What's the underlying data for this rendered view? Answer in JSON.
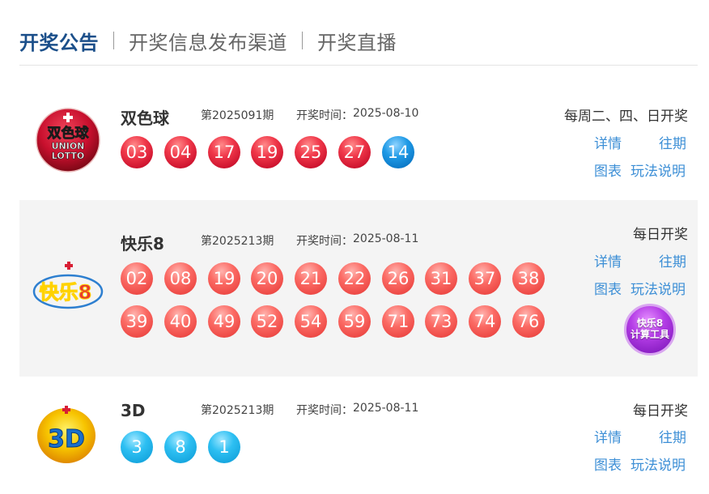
{
  "tabs": [
    {
      "label": "开奖公告",
      "active": true
    },
    {
      "label": "开奖信息发布渠道",
      "active": false
    },
    {
      "label": "开奖直播",
      "active": false
    }
  ],
  "ssq": {
    "name": "双色球",
    "issue": "第2025091期",
    "draw_time_label": "开奖时间：",
    "draw_date": "2025-08-10",
    "schedule": "每周二、四、日开奖",
    "logo_text_cn": "双色球",
    "logo_text_en1": "UNION",
    "logo_text_en2": "LOTTO",
    "red_balls": [
      "03",
      "04",
      "17",
      "19",
      "25",
      "27"
    ],
    "blue_balls": [
      "14"
    ],
    "links": {
      "detail": "详情",
      "history": "往期",
      "chart": "图表",
      "rules": "玩法说明"
    }
  },
  "kl8": {
    "name": "快乐8",
    "issue": "第2025213期",
    "draw_time_label": "开奖时间：",
    "draw_date": "2025-08-11",
    "schedule": "每日开奖",
    "logo_text": "快乐8",
    "balls": [
      "02",
      "08",
      "19",
      "20",
      "21",
      "22",
      "26",
      "31",
      "37",
      "38",
      "39",
      "40",
      "49",
      "52",
      "54",
      "59",
      "71",
      "73",
      "74",
      "76"
    ],
    "calc_line1": "快乐8",
    "calc_line2": "计算工具",
    "links": {
      "detail": "详情",
      "history": "往期",
      "chart": "图表",
      "rules": "玩法说明"
    }
  },
  "fc3d": {
    "name": "3D",
    "issue": "第2025213期",
    "draw_time_label": "开奖时间：",
    "draw_date": "2025-08-11",
    "schedule": "每日开奖",
    "logo_text": "3D",
    "balls": [
      "3",
      "8",
      "1"
    ],
    "links": {
      "detail": "详情",
      "history": "往期",
      "chart": "图表",
      "rules": "玩法说明"
    }
  },
  "colors": {
    "tab_active": "#1b4f8a",
    "link": "#3d8fd6",
    "red_ball": "#d81e34",
    "blue_ball": "#0a80d0",
    "pink_ball": "#f25650",
    "cyan_ball": "#1cb1e8",
    "calc_button": "#9b2fd6"
  },
  "icons": {
    "ssq_logo": "ssq-logo-icon",
    "kl8_logo": "kl8-logo-icon",
    "fc3d_logo": "fc3d-logo-icon"
  }
}
